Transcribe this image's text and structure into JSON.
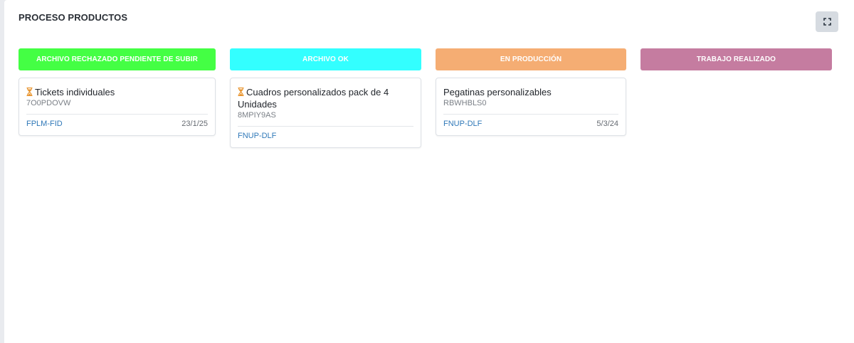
{
  "board": {
    "title": "PROCESO PRODUCTOS",
    "expand_icon": "expand-icon"
  },
  "columns": [
    {
      "label": "ARCHIVO RECHAZADO PENDIENTE DE SUBIR",
      "color": "#44ff44",
      "cards": [
        {
          "icon": "hourglass-icon",
          "title": "Tickets individuales",
          "code": "7O0PDOVW",
          "ref": "FPLM-FID",
          "date": "23/1/25"
        }
      ]
    },
    {
      "label": "ARCHIVO OK",
      "color": "#33ffff",
      "cards": [
        {
          "icon": "hourglass-icon",
          "title": "Cuadros personalizados pack de 4 Unidades",
          "code": "8MPIY9AS",
          "ref": "FNUP-DLF",
          "date": ""
        }
      ]
    },
    {
      "label": "EN PRODUCCIÓN",
      "color": "#f5ad73",
      "cards": [
        {
          "icon": "",
          "title": "Pegatinas personalizables",
          "code": "RBWHBLS0",
          "ref": "FNUP-DLF",
          "date": "5/3/24"
        }
      ]
    },
    {
      "label": "TRABAJO REALIZADO",
      "color": "#c57ca0",
      "cards": []
    }
  ]
}
